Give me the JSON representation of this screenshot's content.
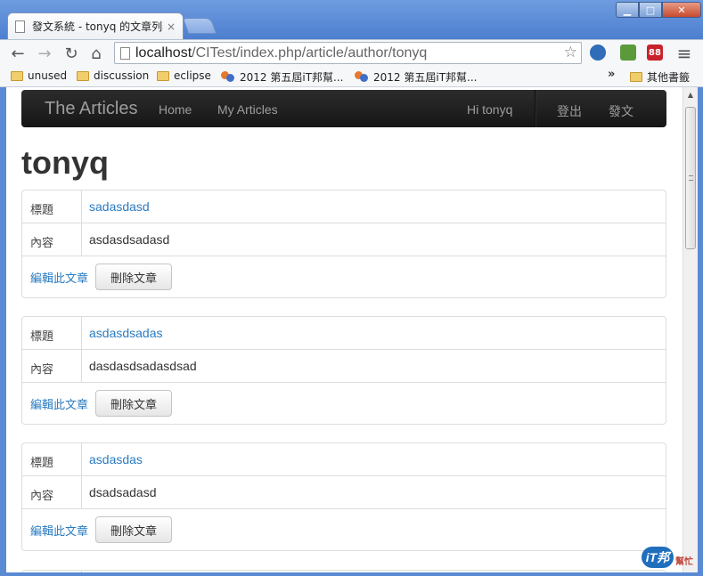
{
  "window": {
    "tab_title": "發文系統 - tonyq 的文章列表",
    "tab_close": "×",
    "min": "▁",
    "max": "□",
    "close": "✕"
  },
  "toolbar": {
    "back_icon": "←",
    "forward_icon": "→",
    "reload_icon": "↻",
    "home_icon": "⌂",
    "url_host": "localhost",
    "url_path": "/CITest/index.php/article/author/tonyq",
    "star_icon": "☆",
    "menu_icon": "≡",
    "ext_badge": "88"
  },
  "bookmarks": {
    "items": [
      {
        "label": "unused",
        "icon": "folder-icon"
      },
      {
        "label": "discussion",
        "icon": "folder-icon"
      },
      {
        "label": "eclipse",
        "icon": "folder-icon"
      },
      {
        "label": "2012 第五屆iT邦幫...",
        "icon": "ithome-icon"
      },
      {
        "label": "2012 第五屆iT邦幫...",
        "icon": "ithome-icon"
      }
    ],
    "more": "»",
    "other": "其他書籤"
  },
  "navbar": {
    "brand": "The Articles",
    "links": [
      "Home",
      "My Articles"
    ],
    "greeting": "Hi tonyq",
    "logout": "登出",
    "post": "發文"
  },
  "page": {
    "title": "tonyq"
  },
  "labels": {
    "title": "標題",
    "content": "內容",
    "edit": "編輯此文章",
    "delete": "刪除文章"
  },
  "articles": [
    {
      "title": "sadasdasd",
      "content": "asdasdsadasd"
    },
    {
      "title": "asdasdsadas",
      "content": "dasdasdsadasdsad"
    },
    {
      "title": "asdasdas",
      "content": "dsadsadasd"
    }
  ],
  "watermark": {
    "badge": "iT邦",
    "text": "幫忙"
  },
  "colors": {
    "link": "#2a7bc1",
    "navbar": "#222222",
    "window_frame": "#5a8ad4"
  }
}
